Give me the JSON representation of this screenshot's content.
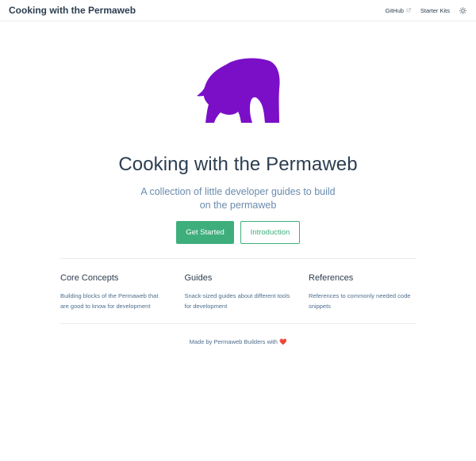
{
  "navbar": {
    "site_title": "Cooking with the Permaweb",
    "links": [
      {
        "label": "GitHub",
        "icon": "external-link-icon"
      },
      {
        "label": "Starter Kits"
      }
    ],
    "theme_icon": "sun-icon"
  },
  "hero": {
    "image_icon": "elephant-logo",
    "image_color": "#7b0fc8",
    "title": "Cooking with the Permaweb",
    "description": "A collection of little developer guides to build on the permaweb",
    "actions": [
      {
        "label": "Get Started",
        "style": "primary"
      },
      {
        "label": "Introduction",
        "style": "secondary"
      }
    ]
  },
  "features": [
    {
      "title": "Core Concepts",
      "details": "Building blocks of the Permaweb that are good to know for development"
    },
    {
      "title": "Guides",
      "details": "Snack-sized guides about different tools for development"
    },
    {
      "title": "References",
      "details": "References to commonly needed code snippets"
    }
  ],
  "footer": {
    "text": "Made by Permaweb Builders with",
    "heart": "❤️"
  },
  "colors": {
    "accent": "#3eaf7c",
    "text": "#2c3e50",
    "muted": "#6a8bad"
  }
}
